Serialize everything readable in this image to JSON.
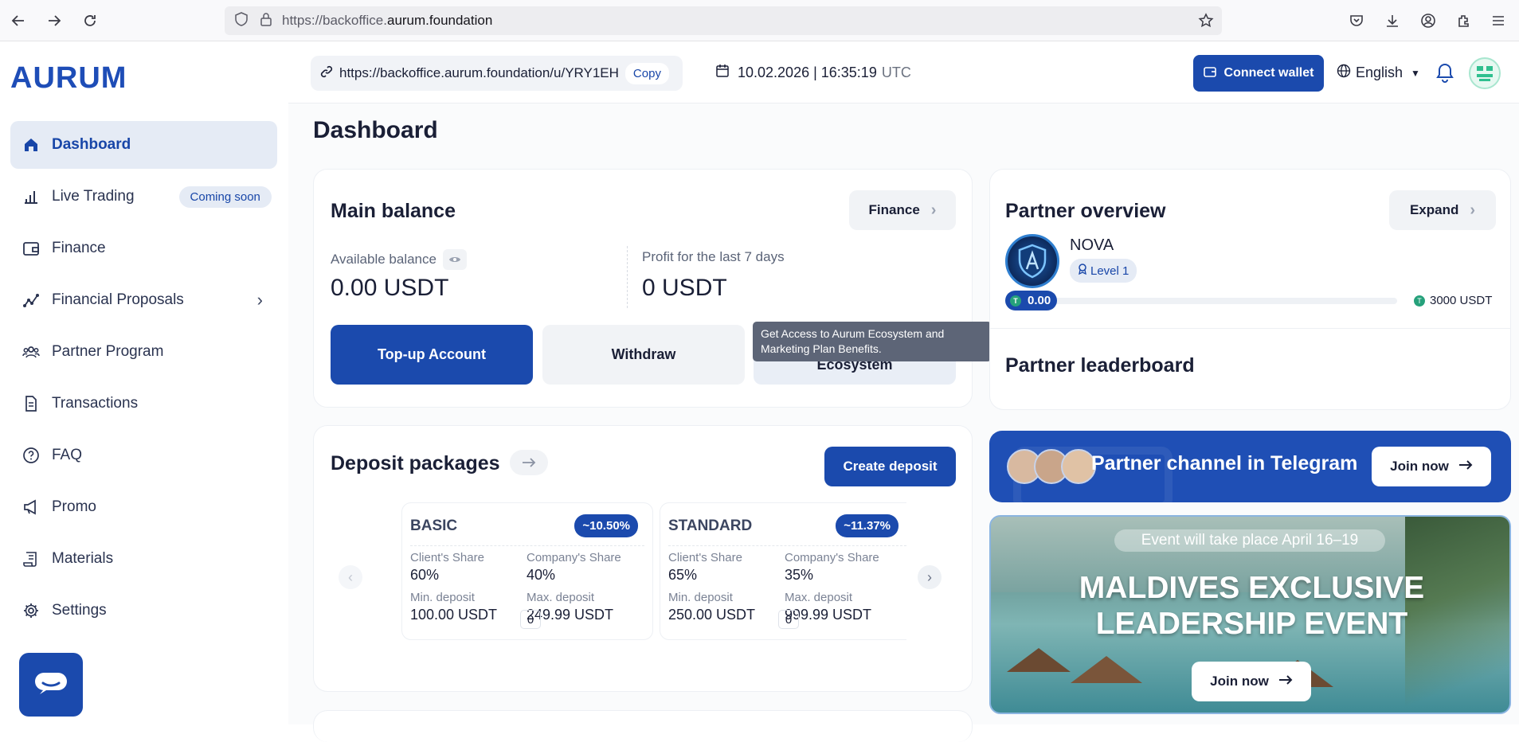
{
  "browser": {
    "url_prefix": "https://backoffice.",
    "url_host": "aurum.foundation"
  },
  "sidebar": {
    "logo": "AURUM",
    "items": [
      {
        "label": "Dashboard",
        "icon": "home-icon"
      },
      {
        "label": "Live Trading",
        "icon": "bar-chart-icon",
        "badge": "Coming soon"
      },
      {
        "label": "Finance",
        "icon": "wallet-icon"
      },
      {
        "label": "Financial Proposals",
        "icon": "trend-icon"
      },
      {
        "label": "Partner Program",
        "icon": "people-icon"
      },
      {
        "label": "Transactions",
        "icon": "document-icon"
      },
      {
        "label": "FAQ",
        "icon": "question-icon"
      },
      {
        "label": "Promo",
        "icon": "megaphone-icon"
      },
      {
        "label": "Materials",
        "icon": "scroll-icon"
      },
      {
        "label": "Settings",
        "icon": "gear-icon"
      }
    ]
  },
  "topbar": {
    "ref_link": "https://backoffice.aurum.foundation/u/YRY1EH",
    "copy_label": "Copy",
    "date": "10.02.2026 | 16:35:19",
    "tz": "UTC",
    "connect_wallet": "Connect wallet",
    "language": "English"
  },
  "page_title": "Dashboard",
  "main_balance": {
    "title": "Main balance",
    "finance_btn": "Finance",
    "available_label": "Available balance",
    "available_value": "0.00 USDT",
    "profit_label": "Profit for the last 7 days",
    "profit_value": "0 USDT",
    "topup": "Top-up Account",
    "withdraw": "Withdraw",
    "access": "Access to Aurum Ecosystem",
    "tooltip": "Get Access to Aurum Ecosystem and Marketing Plan Benefits."
  },
  "deposits": {
    "title": "Deposit packages",
    "create": "Create deposit",
    "packages": [
      {
        "name": "BASIC",
        "pct": "~10.50%",
        "client_label": "Client's Share",
        "client": "60%",
        "company_label": "Company's Share",
        "company": "40%",
        "min_label": "Min. deposit",
        "min": "100.00 USDT",
        "max_label": "Max. deposit",
        "max": "249.99 USDT",
        "count": "0"
      },
      {
        "name": "STANDARD",
        "pct": "~11.37%",
        "client_label": "Client's Share",
        "client": "65%",
        "company_label": "Company's Share",
        "company": "35%",
        "min_label": "Min. deposit",
        "min": "250.00 USDT",
        "max_label": "Max. deposit",
        "max": "999.99 USDT",
        "count": "0"
      }
    ]
  },
  "partner": {
    "title": "Partner overview",
    "expand": "Expand",
    "rank": "NOVA",
    "level": "Level 1",
    "progress_current": "0.00",
    "progress_target": "3000 USDT",
    "progress_fraction": 0,
    "leaderboard": "Partner leaderboard"
  },
  "telegram": {
    "text": "Partner channel in Telegram",
    "join": "Join now"
  },
  "event": {
    "date": "Event will take place April 16–19",
    "title_line1": "MALDIVES EXCLUSIVE",
    "title_line2": "LEADERSHIP EVENT",
    "join": "Join now"
  },
  "colors": {
    "primary": "#1b4aad",
    "active_bg": "#e5ebf5",
    "usdt_green": "#26a17b"
  }
}
